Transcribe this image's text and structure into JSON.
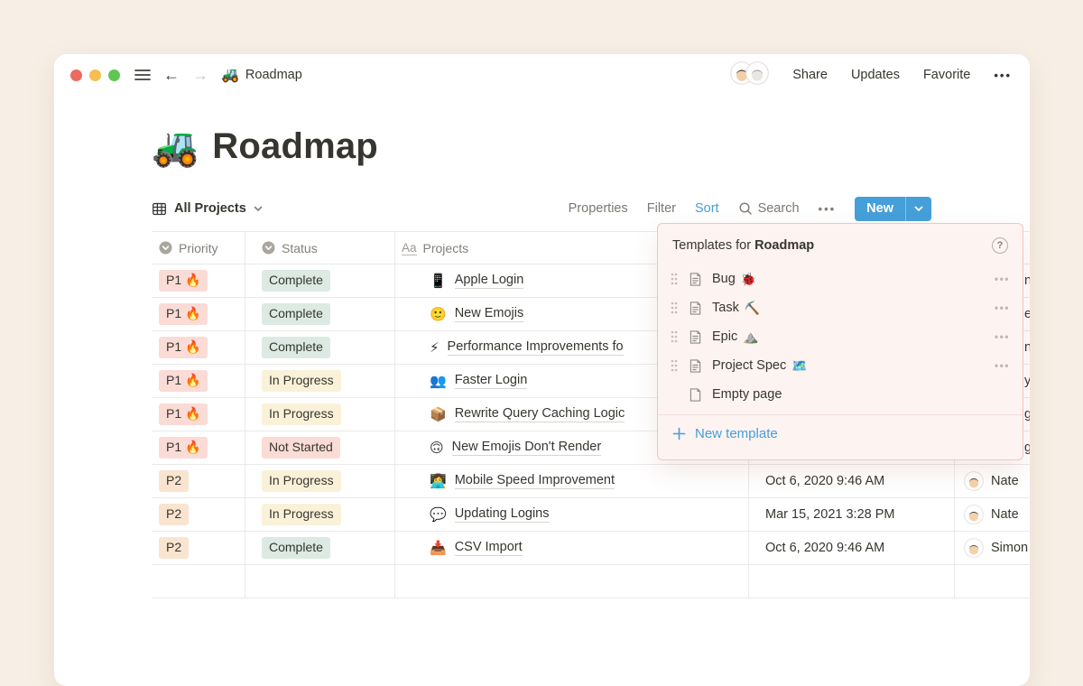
{
  "colors": {
    "accent_blue": "#459FD9",
    "pill_red": "#FBDBD6",
    "pill_orange": "#F9E4D0",
    "pill_green": "#DCEAE3",
    "pill_yellow": "#FAF1D9",
    "popup_bg": "#FDF3F0",
    "popup_border": "#F2C6BF"
  },
  "topbar": {
    "doc_emoji": "🚜",
    "doc_title": "Roadmap",
    "share": "Share",
    "updates": "Updates",
    "favorite": "Favorite",
    "more": "•••"
  },
  "page": {
    "emoji": "🚜",
    "title": "Roadmap"
  },
  "viewbar": {
    "view_label": "All Projects",
    "properties": "Properties",
    "filter": "Filter",
    "sort": "Sort",
    "search": "Search",
    "more": "•••",
    "new_label": "New"
  },
  "table": {
    "headers": [
      {
        "icon": "select",
        "label": "Priority"
      },
      {
        "icon": "select",
        "label": "Status"
      },
      {
        "icon": "aa",
        "label": "Projects"
      }
    ],
    "rows": [
      {
        "priority": "P1 🔥",
        "priority_color": "red",
        "status": "Complete",
        "status_color": "green",
        "emoji": "📱",
        "project": "Apple Login",
        "date": "",
        "person": ""
      },
      {
        "priority": "P1 🔥",
        "priority_color": "red",
        "status": "Complete",
        "status_color": "green",
        "emoji": "🙂",
        "project": "New Emojis",
        "date": "",
        "person": ""
      },
      {
        "priority": "P1 🔥",
        "priority_color": "red",
        "status": "Complete",
        "status_color": "green",
        "emoji": "⚡",
        "project": "Performance Improvements fo",
        "date": "",
        "person": ""
      },
      {
        "priority": "P1 🔥",
        "priority_color": "red",
        "status": "In Progress",
        "status_color": "yellow",
        "emoji": "👥",
        "project": "Faster Login",
        "date": "",
        "person": ""
      },
      {
        "priority": "P1 🔥",
        "priority_color": "red",
        "status": "In Progress",
        "status_color": "yellow",
        "emoji": "📦",
        "project": "Rewrite Query Caching Logic",
        "date": "",
        "person": ""
      },
      {
        "priority": "P1 🔥",
        "priority_color": "red",
        "status": "Not Started",
        "status_color": "red",
        "emoji": "🙃",
        "project": "New Emojis Don't Render",
        "date": "",
        "person": ""
      },
      {
        "priority": "P2",
        "priority_color": "orange",
        "status": "In Progress",
        "status_color": "yellow",
        "emoji": "👩‍💻",
        "project": "Mobile Speed Improvement",
        "date": "Oct 6, 2020 9:46 AM",
        "person": "Nate"
      },
      {
        "priority": "P2",
        "priority_color": "orange",
        "status": "In Progress",
        "status_color": "yellow",
        "emoji": "💬",
        "project": "Updating Logins",
        "date": "Mar 15, 2021 3:28 PM",
        "person": "Nate"
      },
      {
        "priority": "P2",
        "priority_color": "orange",
        "status": "Complete",
        "status_color": "green",
        "emoji": "📥",
        "project": "CSV Import",
        "date": "Oct 6, 2020 9:46 AM",
        "person": "Simon"
      }
    ],
    "edge_fragments": [
      "n Z",
      "e",
      "ni",
      "y",
      "ge",
      "ge"
    ]
  },
  "popup": {
    "title_prefix": "Templates for ",
    "title_bold": "Roadmap",
    "help": "?",
    "items": [
      {
        "label": "Bug",
        "emoji": "🐞"
      },
      {
        "label": "Task",
        "emoji": "⛏️"
      },
      {
        "label": "Epic",
        "emoji": "⛰️"
      },
      {
        "label": "Project Spec",
        "emoji": "🗺️"
      }
    ],
    "item_more": "•••",
    "empty_label": "Empty page",
    "new_template_label": "New template"
  }
}
